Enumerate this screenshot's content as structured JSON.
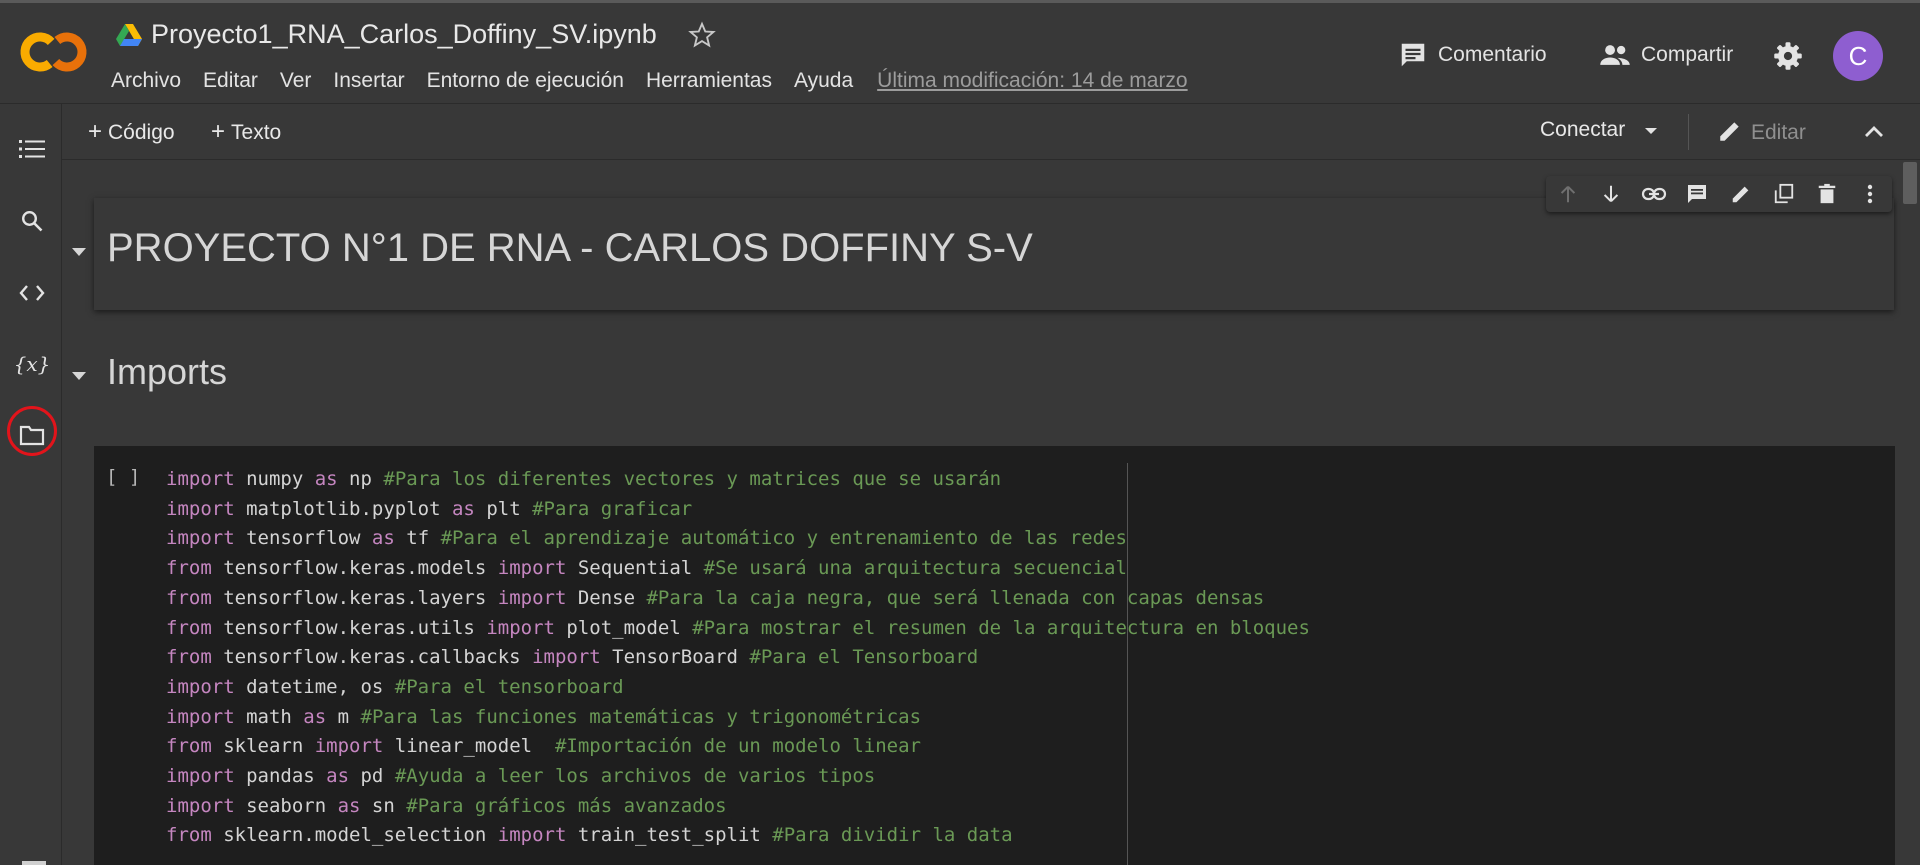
{
  "header": {
    "filename": "Proyecto1_RNA_Carlos_Doffiny_SV.ipynb",
    "menu": [
      "Archivo",
      "Editar",
      "Ver",
      "Insertar",
      "Entorno de ejecución",
      "Herramientas",
      "Ayuda"
    ],
    "last_modified": "Última modificación: 14 de marzo",
    "comment_label": "Comentario",
    "share_label": "Compartir",
    "avatar_letter": "C"
  },
  "toolbar": {
    "add_code": "Código",
    "add_text": "Texto",
    "connect": "Conectar",
    "edit": "Editar"
  },
  "sidebar": {
    "icons": [
      "table-of-contents-icon",
      "search-icon",
      "code-snippets-icon",
      "variables-icon",
      "files-folder-icon"
    ]
  },
  "cells": {
    "title": "PROYECTO N°1 DE RNA - CARLOS DOFFINY S-V",
    "section": "Imports",
    "run_indicator": "[ ]",
    "code_lines": [
      [
        [
          "kw",
          "import"
        ],
        [
          "t",
          " numpy "
        ],
        [
          "kw",
          "as"
        ],
        [
          "t",
          " np "
        ],
        [
          "cm",
          "#Para los diferentes vectores y matrices que se usarán"
        ]
      ],
      [
        [
          "kw",
          "import"
        ],
        [
          "t",
          " matplotlib.pyplot "
        ],
        [
          "kw",
          "as"
        ],
        [
          "t",
          " plt "
        ],
        [
          "cm",
          "#Para graficar"
        ]
      ],
      [
        [
          "kw",
          "import"
        ],
        [
          "t",
          " tensorflow "
        ],
        [
          "kw",
          "as"
        ],
        [
          "t",
          " tf "
        ],
        [
          "cm",
          "#Para el aprendizaje automático y entrenamiento de las redes"
        ]
      ],
      [
        [
          "kw",
          "from"
        ],
        [
          "t",
          " tensorflow.keras.models "
        ],
        [
          "kw",
          "import"
        ],
        [
          "t",
          " Sequential "
        ],
        [
          "cm",
          "#Se usará una arquitectura secuencial"
        ]
      ],
      [
        [
          "kw",
          "from"
        ],
        [
          "t",
          " tensorflow.keras.layers "
        ],
        [
          "kw",
          "import"
        ],
        [
          "t",
          " Dense "
        ],
        [
          "cm",
          "#Para la caja negra, que será llenada con capas densas"
        ]
      ],
      [
        [
          "kw",
          "from"
        ],
        [
          "t",
          " tensorflow.keras.utils "
        ],
        [
          "kw",
          "import"
        ],
        [
          "t",
          " plot_model "
        ],
        [
          "cm",
          "#Para mostrar el resumen de la arquitectura en bloques"
        ]
      ],
      [
        [
          "kw",
          "from"
        ],
        [
          "t",
          " tensorflow.keras.callbacks "
        ],
        [
          "kw",
          "import"
        ],
        [
          "t",
          " TensorBoard "
        ],
        [
          "cm",
          "#Para el Tensorboard"
        ]
      ],
      [
        [
          "kw",
          "import"
        ],
        [
          "t",
          " datetime, os "
        ],
        [
          "cm",
          "#Para el tensorboard"
        ]
      ],
      [
        [
          "kw",
          "import"
        ],
        [
          "t",
          " math "
        ],
        [
          "kw",
          "as"
        ],
        [
          "t",
          " m "
        ],
        [
          "cm",
          "#Para las funciones matemáticas y trigonométricas"
        ]
      ],
      [
        [
          "kw",
          "from"
        ],
        [
          "t",
          " sklearn "
        ],
        [
          "kw",
          "import"
        ],
        [
          "t",
          " linear_model  "
        ],
        [
          "cm",
          "#Importación de un modelo linear"
        ]
      ],
      [
        [
          "kw",
          "import"
        ],
        [
          "t",
          " pandas "
        ],
        [
          "kw",
          "as"
        ],
        [
          "t",
          " pd "
        ],
        [
          "cm",
          "#Ayuda a leer los archivos de varios tipos"
        ]
      ],
      [
        [
          "kw",
          "import"
        ],
        [
          "t",
          " seaborn "
        ],
        [
          "kw",
          "as"
        ],
        [
          "t",
          " sn "
        ],
        [
          "cm",
          "#Para gráficos más avanzados"
        ]
      ],
      [
        [
          "kw",
          "from"
        ],
        [
          "t",
          " sklearn.model_selection "
        ],
        [
          "kw",
          "import"
        ],
        [
          "t",
          " train_test_split "
        ],
        [
          "cm",
          "#Para dividir la data"
        ]
      ]
    ]
  },
  "colors": {
    "background": "#383838",
    "code_background": "#1e1e1e",
    "keyword": "#c586c0",
    "comment": "#6a9955",
    "avatar": "#8e5ed0",
    "highlight_circle": "#e2141b"
  }
}
